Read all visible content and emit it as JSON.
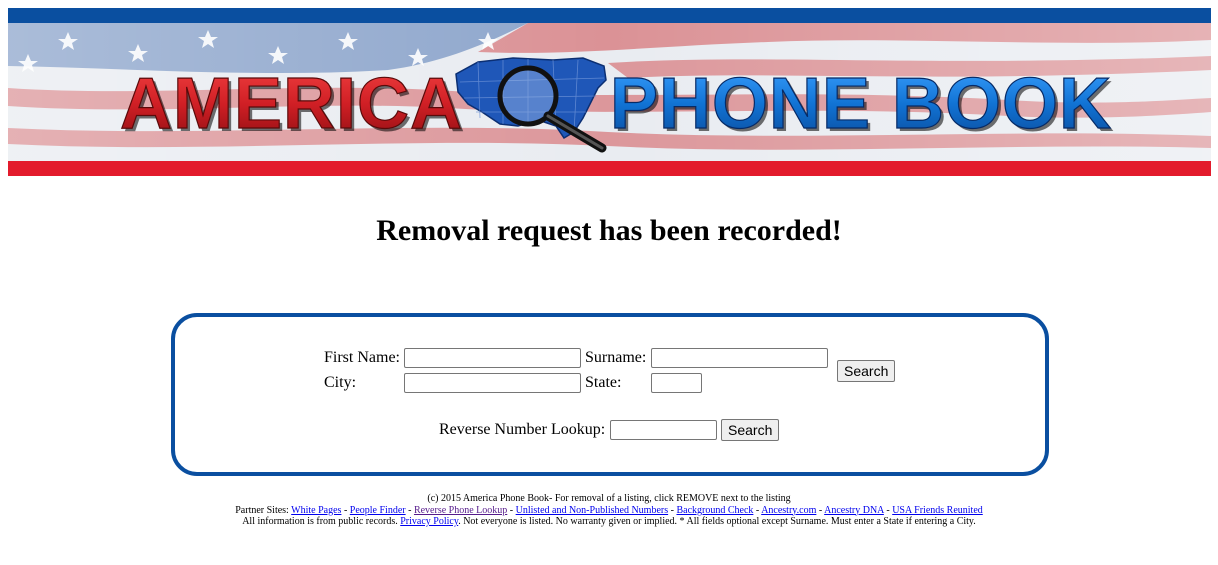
{
  "banner": {
    "word_left": "AMERICA",
    "word_right": "PHONE BOOK",
    "colors": {
      "top_band": "#0a4fa0",
      "bottom_band": "#e31b2c",
      "left_word": "#d01f25",
      "right_word": "#1173d4",
      "map": "#1f57b8"
    }
  },
  "page": {
    "title": "Removal request has been recorded!"
  },
  "search": {
    "first_name_label": "First Name:",
    "surname_label": "Surname:",
    "city_label": "City:",
    "state_label": "State:",
    "search_button": "Search",
    "first_name_value": "",
    "surname_value": "",
    "city_value": "",
    "state_value": ""
  },
  "reverse": {
    "label": "Reverse Number Lookup:",
    "value": "",
    "search_button": "Search"
  },
  "footer": {
    "line1": "(c) 2015 America Phone Book- For removal of a listing, click REMOVE next to the listing",
    "partner_prefix": "Partner Sites:",
    "partners": [
      "White Pages",
      "People Finder",
      "Reverse Phone Lookup",
      "Unlisted and Non-Published Numbers",
      "Background Check",
      "Ancestry.com",
      "Ancestry DNA",
      "USA Friends Reunited"
    ],
    "separator": " - ",
    "line3_pre": "All information is from public records.",
    "privacy": "Privacy Policy",
    "line3_post": ". Not everyone is listed. No warranty given or implied. * All fields optional except Surname. Must enter a State if entering a City."
  }
}
